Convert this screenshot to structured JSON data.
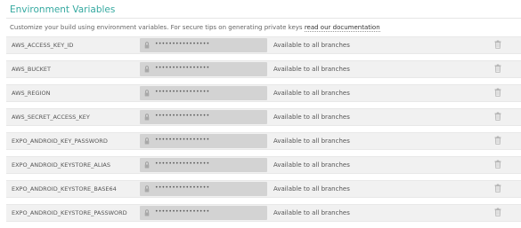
{
  "header": {
    "title": "Environment Variables",
    "subtitle_prefix": "Customize your build using environment variables. For secure tips on generating private keys ",
    "subtitle_link": "read our documentation"
  },
  "variables": [
    {
      "key": "AWS_ACCESS_KEY_ID",
      "value": "••••••••••••••••",
      "scope": "Available to all branches"
    },
    {
      "key": "AWS_BUCKET",
      "value": "••••••••••••••••",
      "scope": "Available to all branches"
    },
    {
      "key": "AWS_REGION",
      "value": "••••••••••••••••",
      "scope": "Available to all branches"
    },
    {
      "key": "AWS_SECRET_ACCESS_KEY",
      "value": "••••••••••••••••",
      "scope": "Available to all branches"
    },
    {
      "key": "EXPO_ANDROID_KEY_PASSWORD",
      "value": "••••••••••••••••",
      "scope": "Available to all branches"
    },
    {
      "key": "EXPO_ANDROID_KEYSTORE_ALIAS",
      "value": "••••••••••••••••",
      "scope": "Available to all branches"
    },
    {
      "key": "EXPO_ANDROID_KEYSTORE_BASE64",
      "value": "••••••••••••••••",
      "scope": "Available to all branches"
    },
    {
      "key": "EXPO_ANDROID_KEYSTORE_PASSWORD",
      "value": "••••••••••••••••",
      "scope": "Available to all branches"
    }
  ],
  "icons": {
    "lock": "lock-icon",
    "delete": "trash-icon"
  },
  "colors": {
    "title": "#35a9a0",
    "row_bg": "#f1f1f1",
    "value_bg": "#d3d3d3"
  }
}
